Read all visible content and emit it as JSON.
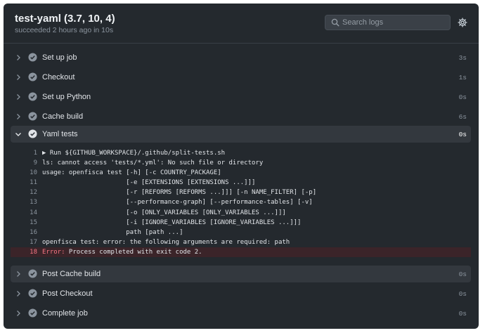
{
  "job": {
    "title": "test-yaml (3.7, 10, 4)",
    "subtitle": "succeeded 2 hours ago in 10s"
  },
  "search": {
    "placeholder": "Search logs"
  },
  "icons": {
    "search": "search-icon",
    "settings": "gear-icon",
    "chevron_right": "chevron-right-icon",
    "chevron_down": "chevron-down-icon",
    "success": "check-circle-icon"
  },
  "colors": {
    "panel_bg": "#24292e",
    "error_text": "#f97583",
    "error_bg": "#3b2429",
    "active_step_bg": "#33383e"
  },
  "steps_before": [
    {
      "label": "Set up job",
      "duration": "3s"
    },
    {
      "label": "Checkout",
      "duration": "1s"
    },
    {
      "label": "Set up Python",
      "duration": "0s"
    },
    {
      "label": "Cache build",
      "duration": "6s"
    }
  ],
  "expanded_step": {
    "label": "Yaml tests",
    "duration": "0s"
  },
  "log_lines": [
    {
      "num": "1",
      "text": "▶ Run ${GITHUB_WORKSPACE}/.github/split-tests.sh"
    },
    {
      "num": "9",
      "text": "ls: cannot access 'tests/*.yml': No such file or directory"
    },
    {
      "num": "10",
      "text": "usage: openfisca test [-h] [-c COUNTRY_PACKAGE]"
    },
    {
      "num": "11",
      "text": "                      [-e [EXTENSIONS [EXTENSIONS ...]]]"
    },
    {
      "num": "12",
      "text": "                      [-r [REFORMS [REFORMS ...]]] [-n NAME_FILTER] [-p]"
    },
    {
      "num": "13",
      "text": "                      [--performance-graph] [--performance-tables] [-v]"
    },
    {
      "num": "14",
      "text": "                      [-o [ONLY_VARIABLES [ONLY_VARIABLES ...]]]"
    },
    {
      "num": "15",
      "text": "                      [-i [IGNORE_VARIABLES [IGNORE_VARIABLES ...]]]"
    },
    {
      "num": "16",
      "text": "                      path [path ...]"
    },
    {
      "num": "17",
      "text": "openfisca test: error: the following arguments are required: path"
    }
  ],
  "error_line": {
    "num": "18",
    "keyword": "Error:",
    "text": " Process completed with exit code 2."
  },
  "steps_after": [
    {
      "label": "Post Cache build",
      "duration": "0s"
    },
    {
      "label": "Post Checkout",
      "duration": "0s"
    },
    {
      "label": "Complete job",
      "duration": "0s"
    }
  ]
}
